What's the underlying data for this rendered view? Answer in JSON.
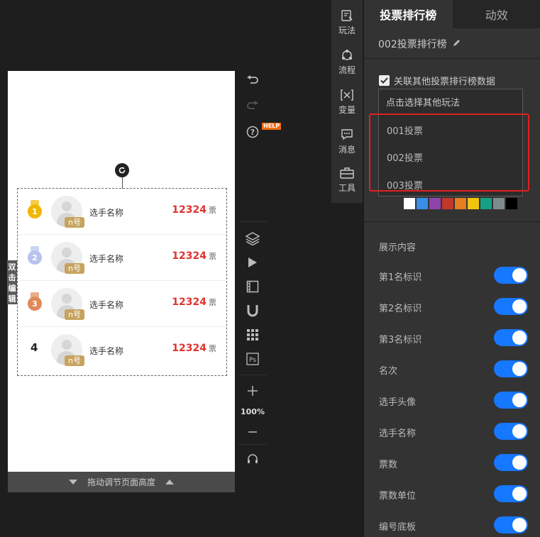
{
  "canvas": {
    "edit_tag": "双击编辑",
    "resize_label": "拖动调节页面高度",
    "ranking": [
      {
        "rank": "1",
        "medal": "gold",
        "badge": "n号",
        "name": "选手名称",
        "votes": "12324",
        "unit": "票"
      },
      {
        "rank": "2",
        "medal": "silver",
        "badge": "n号",
        "name": "选手名称",
        "votes": "12324",
        "unit": "票"
      },
      {
        "rank": "3",
        "medal": "bronze",
        "badge": "n号",
        "name": "选手名称",
        "votes": "12324",
        "unit": "票"
      },
      {
        "rank": "4",
        "medal": "none",
        "badge": "n号",
        "name": "选手名称",
        "votes": "12324",
        "unit": "票"
      }
    ]
  },
  "toolbar": {
    "help_badge": "HELP",
    "zoom": "100%",
    "icons": [
      "undo-icon",
      "redo-icon",
      "help-icon",
      "layers-icon",
      "play-icon",
      "film-icon",
      "magnet-icon",
      "grid-icon",
      "ps-icon",
      "zoom-in-icon",
      "zoom-out-icon",
      "headset-icon"
    ]
  },
  "categories": [
    {
      "label": "玩法",
      "icon": "gameplay-icon"
    },
    {
      "label": "流程",
      "icon": "flow-icon"
    },
    {
      "label": "变量",
      "icon": "variable-icon"
    },
    {
      "label": "消息",
      "icon": "message-icon"
    },
    {
      "label": "工具",
      "icon": "toolbox-icon"
    }
  ],
  "panel": {
    "tabs": [
      "投票排行榜",
      "动效"
    ],
    "title": "002投票排行榜",
    "link_checkbox_label": "关联其他投票排行榜数据",
    "dropdown": {
      "placeholder": "点击选择其他玩法",
      "options": [
        "001投票",
        "002投票",
        "003投票"
      ]
    },
    "swatch_colors": [
      "#ffffff",
      "#3a8ee6",
      "#8e44ad",
      "#c0392b",
      "#e67e22",
      "#f1c40f",
      "#16a085",
      "#7f8c8d",
      "#000000"
    ],
    "display_section_title": "展示内容",
    "display_options": [
      {
        "label": "第1名标识",
        "on": true
      },
      {
        "label": "第2名标识",
        "on": true
      },
      {
        "label": "第3名标识",
        "on": true
      },
      {
        "label": "名次",
        "on": true
      },
      {
        "label": "选手头像",
        "on": true
      },
      {
        "label": "选手名称",
        "on": true
      },
      {
        "label": "票数",
        "on": true
      },
      {
        "label": "票数单位",
        "on": true
      },
      {
        "label": "编号底板",
        "on": true
      }
    ],
    "accent_color": "#1677ff"
  }
}
